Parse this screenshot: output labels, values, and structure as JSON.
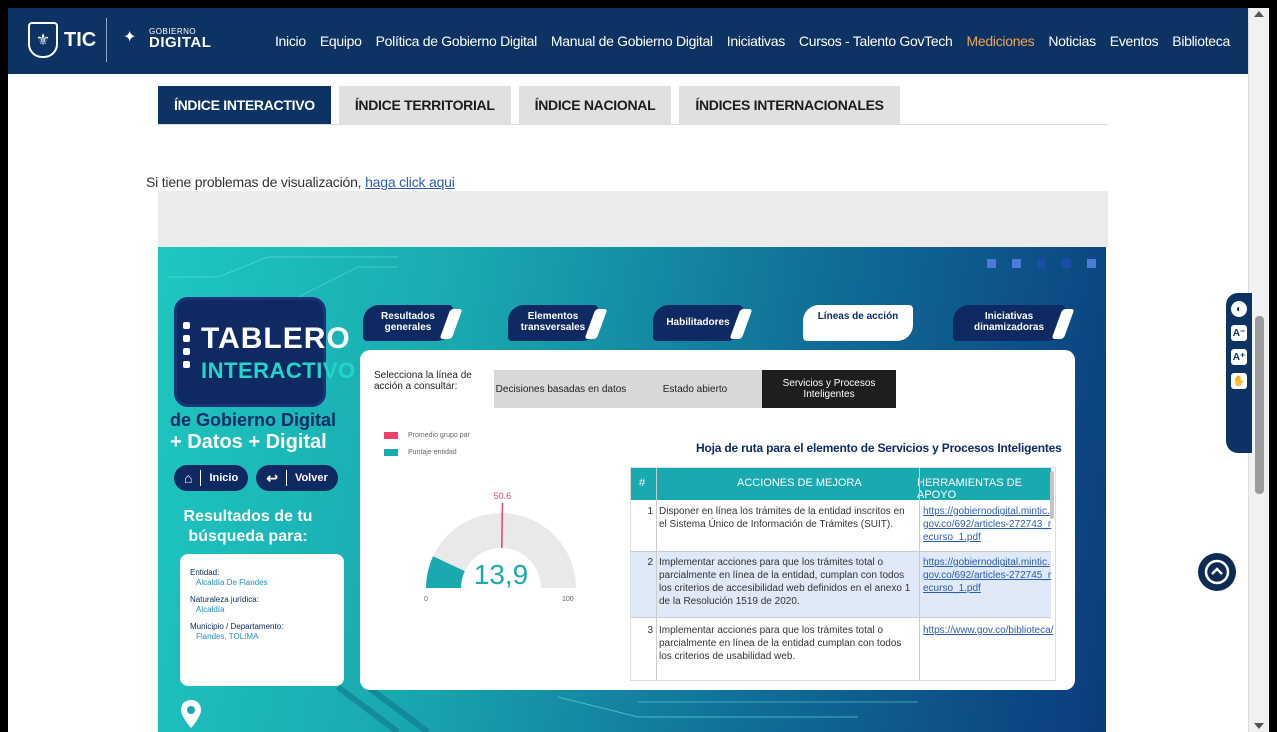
{
  "nav": {
    "logo_tic": "TIC",
    "logo_gob_top": "GOBIERNO",
    "logo_gob_main": "DIGITAL",
    "links": [
      {
        "label": "Inicio"
      },
      {
        "label": "Equipo"
      },
      {
        "label": "Política de Gobierno Digital"
      },
      {
        "label": "Manual de Gobierno Digital"
      },
      {
        "label": "Iniciativas"
      },
      {
        "label": "Cursos - Talento GovTech"
      },
      {
        "label": "Mediciones"
      },
      {
        "label": "Noticias"
      },
      {
        "label": "Eventos"
      },
      {
        "label": "Biblioteca"
      }
    ],
    "active": "Mediciones",
    "active_color": "#f0a64a"
  },
  "tabs": [
    "ÍNDICE INTERACTIVO",
    "ÍNDICE TERRITORIAL",
    "ÍNDICE NACIONAL",
    "ÍNDICES INTERNACIONALES"
  ],
  "viz_msg": {
    "text": "Si tiene problemas de visualización, ",
    "link": "haga click aqui"
  },
  "dashboard": {
    "tablero_word1": "TABLERO",
    "tablero_word2": "INTERACTIVO",
    "subtitle1": "de Gobierno Digital",
    "subtitle2": "+ Datos + Digital",
    "btn_inicio": "Inicio",
    "btn_volver": "Volver",
    "results_title": "Resultados de tu búsqueda para:",
    "entity": {
      "entidad_label": "Entidad:",
      "entidad_value": "Alcaldía De Flandes",
      "naturaleza_label": "Naturaleza jurídica:",
      "naturaleza_value": "Alcaldía",
      "municipio_label": "Municipio / Departamento:",
      "municipio_value": "Flandes, TOLIMA"
    },
    "categories": [
      "Resultados generales",
      "Elementos transversales",
      "Habilitadores",
      "Líneas de acción",
      "Iniciativas dinamizadoras"
    ],
    "active_category": "Líneas de acción",
    "selector_label": "Selecciona la línea de acción a consultar:",
    "segments": [
      "Decisiones basadas en datos",
      "Estado abierto",
      "Servicios y Procesos Inteligentes"
    ],
    "active_segment": "Servicios y Procesos Inteligentes",
    "legend": [
      {
        "label": "Promedio grupo par",
        "color": "#e8436b"
      },
      {
        "label": "Puntaje entidad",
        "color": "#19aab0"
      }
    ]
  },
  "gauge": {
    "value": 13.9,
    "value_label": "13,9",
    "avg": 50.6,
    "avg_label": "50.6",
    "min_label": "0",
    "max_label": "100"
  },
  "roadmap": {
    "title": "Hoja de ruta para el elemento de Servicios y Procesos Inteligentes",
    "headers": {
      "num": "#",
      "action": "ACCIONES DE MEJORA",
      "tool": "HERRAMIENTAS DE APOYO"
    },
    "rows": [
      {
        "num": "1",
        "action": "Disponer en línea los trámites de la entidad inscritos en el Sistema Único de Información de Trámites (SUIT).",
        "tool": "https://gobiernodigital.mintic.gov.co/692/articles-272743_recurso_1.pdf"
      },
      {
        "num": "2",
        "action": "Implementar acciones para que los trámites total o parcialmente en línea de la entidad, cumplan con todos los criterios de accesibilidad web definidos en el anexo 1 de la Resolución 1519 de 2020.",
        "tool": "https://gobiernodigital.mintic.gov.co/692/articles-272745_recurso_1.pdf"
      },
      {
        "num": "3",
        "action": "Implementar acciones para que los trámites total o parcialmente en línea de la entidad cumplan con todos los criterios de usabilidad web.",
        "tool": "https://www.gov.co/biblioteca/"
      }
    ]
  }
}
